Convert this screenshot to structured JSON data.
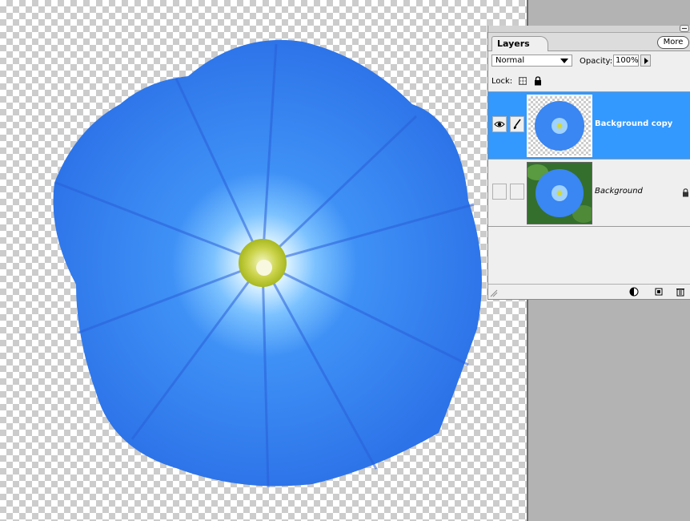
{
  "canvas": {
    "flower_petal_color": "#2f7ff0",
    "flower_center_color": "#d8e060"
  },
  "layers_palette": {
    "tab_label": "Layers",
    "more_button": "More",
    "blend_mode": "Normal",
    "opacity_label": "Opacity:",
    "opacity_value": "100%",
    "lock_label": "Lock:",
    "layers": [
      {
        "name": "Background copy",
        "selected": true,
        "visible": true,
        "locked": false,
        "thumbnail": "transparent-background"
      },
      {
        "name": "Background",
        "selected": false,
        "visible": false,
        "locked": true,
        "thumbnail": "green-leaves-background"
      }
    ],
    "bottom_icons": [
      "adjustment-layer-icon",
      "new-layer-icon",
      "trash-icon"
    ],
    "selection_color": "#3399ff"
  }
}
